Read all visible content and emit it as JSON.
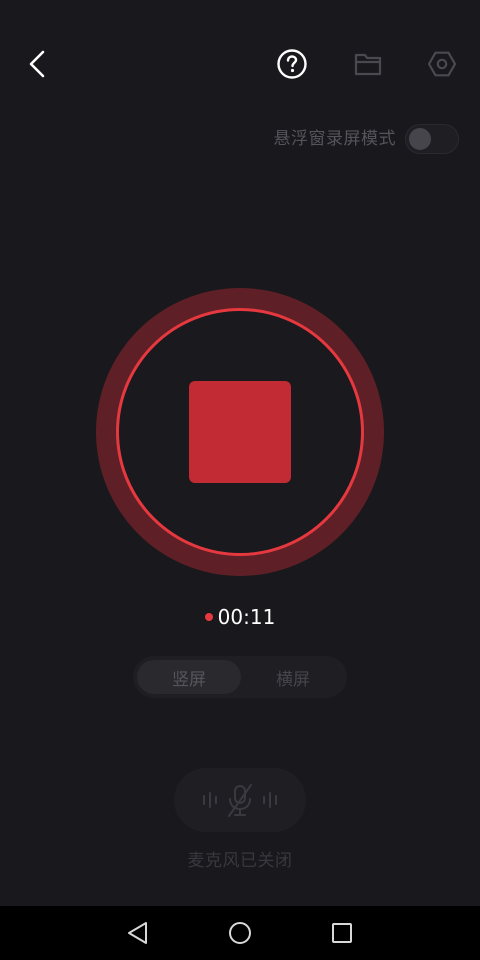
{
  "icons": {
    "back": "back-arrow-icon",
    "help": "help-icon",
    "folder": "folder-icon",
    "settings": "settings-icon"
  },
  "floating_window": {
    "label": "悬浮窗录屏模式",
    "enabled": false
  },
  "recording": {
    "timer": "00:11",
    "indicator_color": "#e5383f",
    "stop_color": "#c22b33"
  },
  "orientation": {
    "options": [
      "竖屏",
      "横屏"
    ],
    "selected": "竖屏"
  },
  "microphone": {
    "status": "麦克风已关闭",
    "muted": true
  },
  "navbar": {
    "back": "nav-back-icon",
    "home": "nav-home-icon",
    "recents": "nav-recents-icon"
  },
  "colors": {
    "background": "#19181c",
    "accent": "#e5383f",
    "ring": "#5e2026"
  }
}
